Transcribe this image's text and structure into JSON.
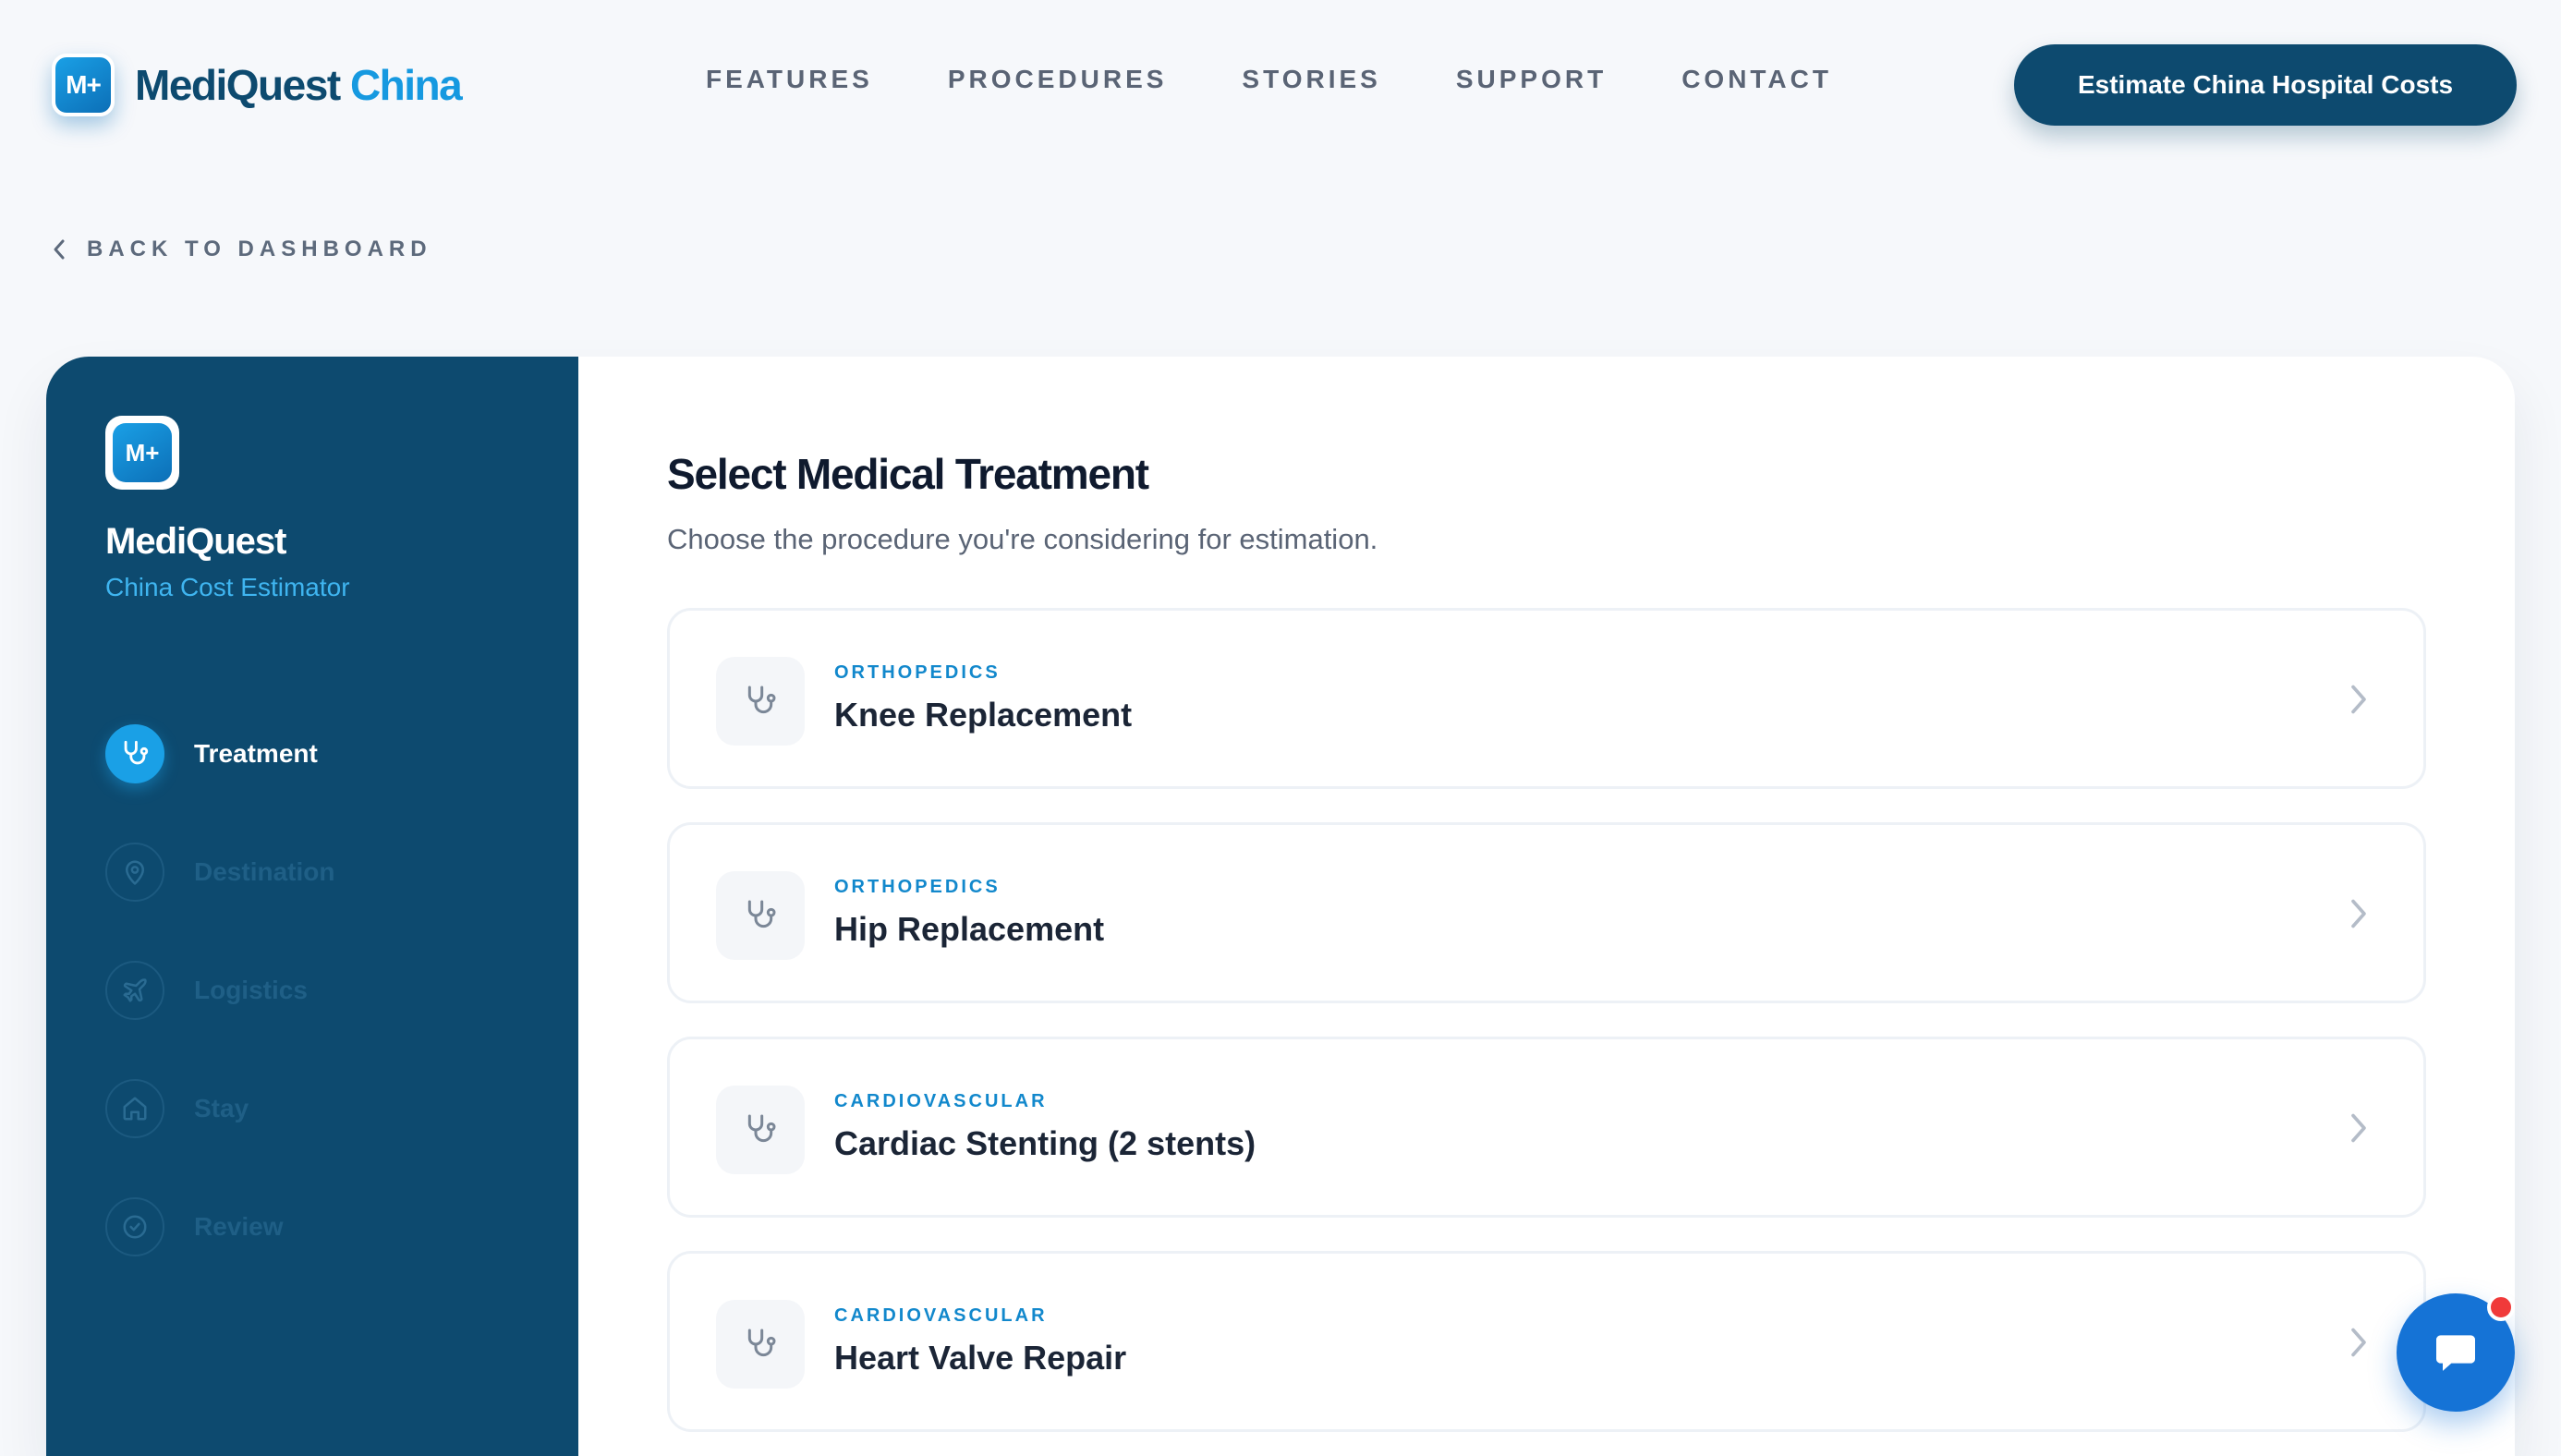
{
  "header": {
    "logo_primary": "MediQuest",
    "logo_accent": "China",
    "logo_mark": "M+",
    "nav": [
      "FEATURES",
      "PROCEDURES",
      "STORIES",
      "SUPPORT",
      "CONTACT"
    ],
    "cta": "Estimate China Hospital Costs"
  },
  "back_link": "BACK TO DASHBOARD",
  "sidebar": {
    "logo_mark": "M+",
    "title": "MediQuest",
    "subtitle": "China Cost Estimator",
    "steps": [
      {
        "label": "Treatment",
        "icon": "stethoscope-icon",
        "active": true
      },
      {
        "label": "Destination",
        "icon": "map-pin-icon",
        "active": false
      },
      {
        "label": "Logistics",
        "icon": "plane-icon",
        "active": false
      },
      {
        "label": "Stay",
        "icon": "home-icon",
        "active": false
      },
      {
        "label": "Review",
        "icon": "check-circle-icon",
        "active": false
      }
    ]
  },
  "main": {
    "title": "Select Medical Treatment",
    "subtitle": "Choose the procedure you're considering for estimation.",
    "treatments": [
      {
        "category": "ORTHOPEDICS",
        "name": "Knee Replacement"
      },
      {
        "category": "ORTHOPEDICS",
        "name": "Hip Replacement"
      },
      {
        "category": "CARDIOVASCULAR",
        "name": "Cardiac Stenting (2 stents)"
      },
      {
        "category": "CARDIOVASCULAR",
        "name": "Heart Valve Repair"
      }
    ]
  },
  "colors": {
    "brand_dark": "#0d4a6f",
    "brand_accent": "#1699e0",
    "chat_button": "#1573d6",
    "notification": "#f03a3a"
  }
}
